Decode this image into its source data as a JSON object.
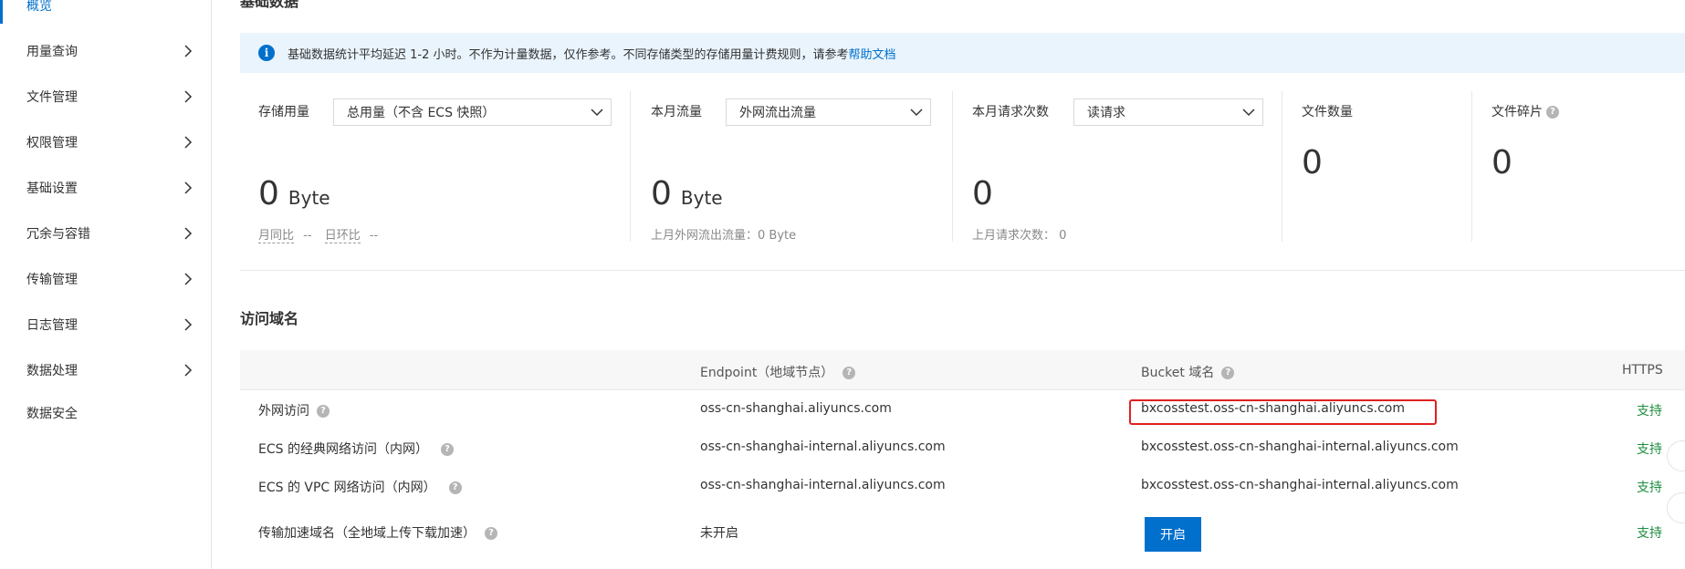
{
  "sidebar": {
    "items": [
      {
        "label": "概览",
        "active": true
      },
      {
        "label": "用量查询"
      },
      {
        "label": "文件管理"
      },
      {
        "label": "权限管理"
      },
      {
        "label": "基础设置"
      },
      {
        "label": "冗余与容错"
      },
      {
        "label": "传输管理"
      },
      {
        "label": "日志管理"
      },
      {
        "label": "数据处理"
      },
      {
        "label": "数据安全"
      }
    ]
  },
  "basic_data": {
    "title": "基础数据",
    "notice": {
      "text": "基础数据统计平均延迟 1-2 小时。不作为计量数据，仅作参考。不同存储类型的存储用量计费规则，请参考",
      "link": "帮助文档"
    },
    "stats": {
      "storage": {
        "label": "存储用量",
        "select": "总用量（不含 ECS 快照）",
        "value": "0",
        "unit": "Byte",
        "sub_month": "月同比",
        "sub_month_val": "--",
        "sub_day": "日环比",
        "sub_day_val": "--"
      },
      "traffic": {
        "label": "本月流量",
        "select": "外网流出流量",
        "value": "0",
        "unit": "Byte",
        "sub": "上月外网流出流量：0 Byte"
      },
      "requests": {
        "label": "本月请求次数",
        "select": "读请求",
        "value": "0",
        "sub": "上月请求次数：  0"
      },
      "files": {
        "label": "文件数量",
        "value": "0"
      },
      "fragments": {
        "label": "文件碎片",
        "value": "0"
      }
    }
  },
  "domains": {
    "title": "访问域名",
    "columns": {
      "endpoint": "Endpoint（地域节点）",
      "bucket": "Bucket 域名",
      "https": "HTTPS"
    },
    "rows": [
      {
        "name": "外网访问",
        "endpoint": "oss-cn-shanghai.aliyuncs.com",
        "bucket": "bxcosstest.oss-cn-shanghai.aliyuncs.com",
        "https": "支持"
      },
      {
        "name": "ECS 的经典网络访问（内网）",
        "endpoint": "oss-cn-shanghai-internal.aliyuncs.com",
        "bucket": "bxcosstest.oss-cn-shanghai-internal.aliyuncs.com",
        "https": "支持"
      },
      {
        "name": "ECS 的 VPC 网络访问（内网）",
        "endpoint": "oss-cn-shanghai-internal.aliyuncs.com",
        "bucket": "bxcosstest.oss-cn-shanghai-internal.aliyuncs.com",
        "https": "支持"
      },
      {
        "name": "传输加速域名（全地域上传下载加速）",
        "endpoint": "未开启",
        "bucket_button": "开启",
        "https": "支持"
      }
    ]
  },
  "colors": {
    "accent": "#0070cc",
    "success": "#1e8e3e",
    "highlight": "#e02020",
    "notice_bg": "#eaf4fd"
  }
}
